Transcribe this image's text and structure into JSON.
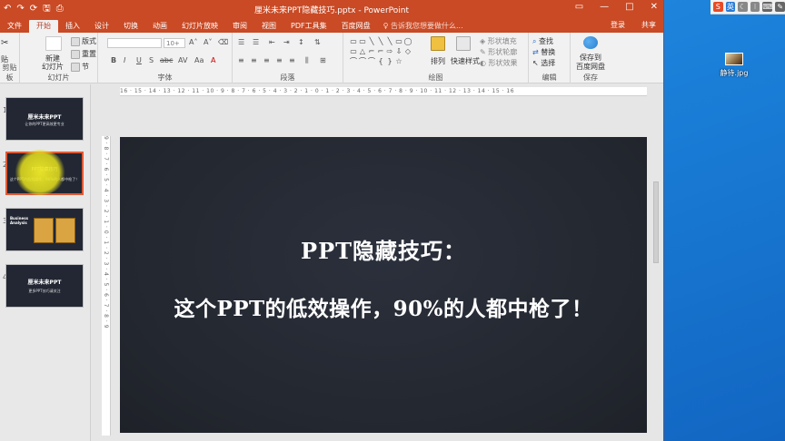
{
  "window": {
    "title": "厘米未来PPT隐藏技巧.pptx - PowerPoint",
    "controls": [
      "▭",
      "—",
      "□",
      "✕"
    ]
  },
  "qat": [
    "↶",
    "↷",
    "⟳",
    "🖫",
    "⎙"
  ],
  "tabs": [
    "文件",
    "开始",
    "插入",
    "设计",
    "切换",
    "动画",
    "幻灯片放映",
    "审阅",
    "视图",
    "PDF工具集",
    "百度网盘"
  ],
  "tell_me": "告诉我您想要做什么...",
  "account": {
    "login": "登录",
    "share": "共享"
  },
  "ribbon": {
    "clipboard": {
      "label": "剪贴板",
      "paste": "贴",
      "cut": "✂"
    },
    "slides": {
      "label": "幻灯片",
      "new_slide": "新建",
      "new_slide2": "幻灯片",
      "layout": "版式",
      "reset": "重置",
      "section": "节"
    },
    "font": {
      "label": "字体",
      "size": "10+",
      "buttons": [
        "B",
        "I",
        "U",
        "S",
        "abc",
        "AV",
        "Aa",
        "A"
      ]
    },
    "paragraph": {
      "label": "段落"
    },
    "drawing": {
      "label": "绘图",
      "shapes": [
        "▭",
        "▭",
        "╲",
        "╲",
        "╲",
        "▭",
        "◯",
        "▭",
        "△",
        "⌐",
        "⌐",
        "⇨",
        "⇩",
        "◇",
        "⌒",
        "⌒",
        "⌒",
        "{",
        "}",
        "☆",
        ""
      ],
      "arrange": "排列",
      "quick_styles": "快速样式",
      "fill": "形状填充",
      "outline": "形状轮廓",
      "effects": "形状效果"
    },
    "editing": {
      "label": "编辑",
      "find": "查找",
      "replace": "替换",
      "select": "选择"
    },
    "save": {
      "label": "保存",
      "save_to": "保存到",
      "baidu": "百度网盘"
    }
  },
  "thumbnails": [
    {
      "num": "1",
      "title": "厘米未来PPT",
      "sub": "让你的PPT更高效更专业"
    },
    {
      "num": "2",
      "title": "PPT隐藏技巧",
      "sub": "这个PPT的低效操作，90%的人都中枪了！"
    },
    {
      "num": "3",
      "title": "Business Analysis",
      "sub": ""
    },
    {
      "num": "4",
      "title": "厘米未来PPT",
      "sub": "更多PPT技巧请关注"
    }
  ],
  "ruler": {
    "horizontal": "16 · 15 · 14 · 13 · 12 · 11 · 10 · 9 · 8 · 7 · 6 · 5 · 4 · 3 · 2 · 1 · 0 · 1 · 2 · 3 · 4 · 5 · 6 · 7 · 8 · 9 · 10 · 11 · 12 · 13 · 14 · 15 · 16",
    "vertical": "9 · 8 · 7 · 6 · 5 · 4 · 3 · 2 · 1 · 0 · 1 · 2 · 3 · 4 · 5 · 6 · 7 · 8 · 9"
  },
  "slide": {
    "title": "PPT隐藏技巧：",
    "subtitle": "这个PPT的低效操作，90%的人都中枪了！"
  },
  "desktop": {
    "tray": [
      "S",
      "英",
      "☾",
      "⁝",
      "⌨",
      "✎"
    ],
    "file_label": "静待.jpg"
  }
}
